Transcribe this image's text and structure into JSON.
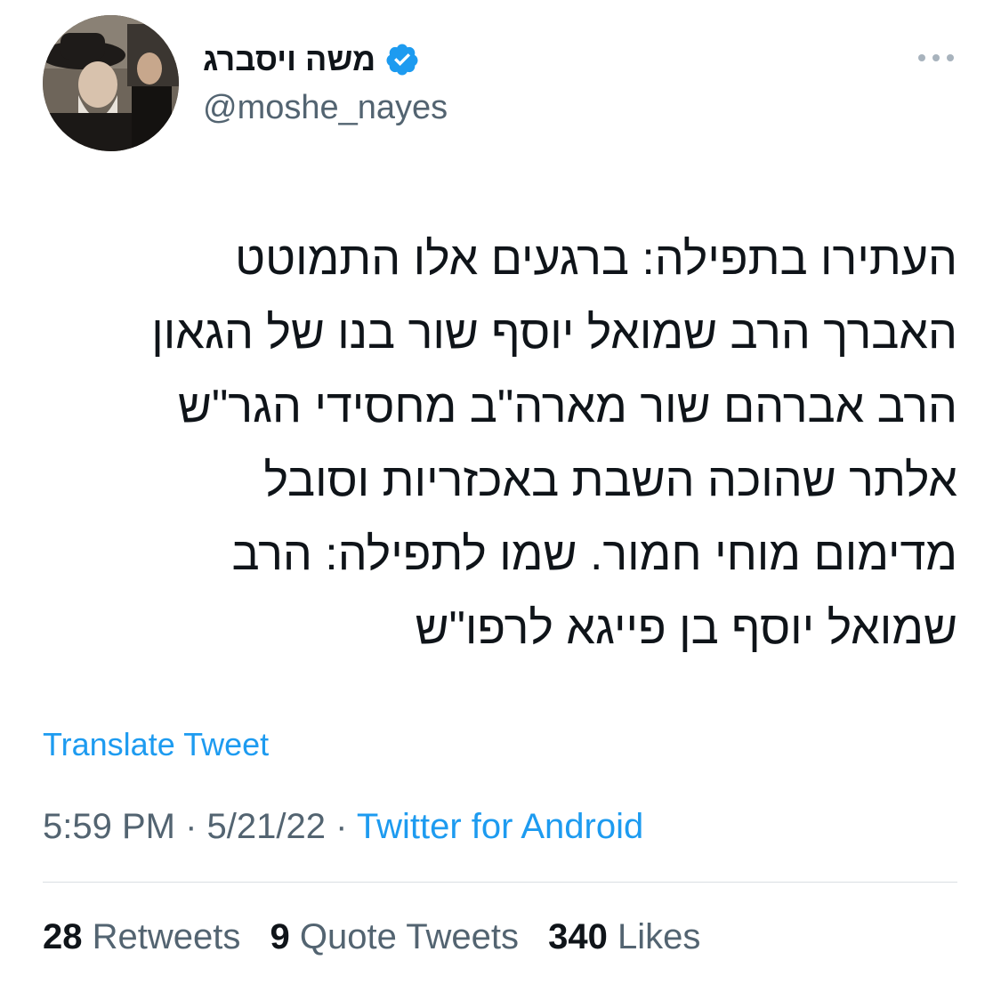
{
  "author": {
    "display_name": "משה ויסברג",
    "handle": "@moshe_nayes",
    "verified_icon": "verified-badge-icon",
    "avatar_icon": "profile-photo"
  },
  "menu_icon": "more-options-icon",
  "tweet": {
    "lines": [
      "העתירו בתפילה: ברגעים אלו התמוטט",
      "האברך הרב שמואל יוסף שור בנו של הגאון",
      "הרב אברהם שור מארה\"ב מחסידי הגר\"ש",
      "אלתר שהוכה השבת באכזריות וסובל",
      "מדימום מוחי חמור. שמו לתפילה: הרב",
      "שמואל יוסף בן פייגא לרפו\"ש"
    ],
    "translate_label": "Translate Tweet"
  },
  "meta": {
    "time": "5:59 PM",
    "separator": "·",
    "date": "5/21/22",
    "source": "Twitter for Android"
  },
  "stats": {
    "retweets_count": "28",
    "retweets_label": "Retweets",
    "quotes_count": "9",
    "quotes_label": "Quote Tweets",
    "likes_count": "340",
    "likes_label": "Likes"
  },
  "colors": {
    "accent": "#1d9bf0",
    "text_primary": "#0f1419",
    "text_secondary": "#536471",
    "divider": "#dadfe3"
  }
}
